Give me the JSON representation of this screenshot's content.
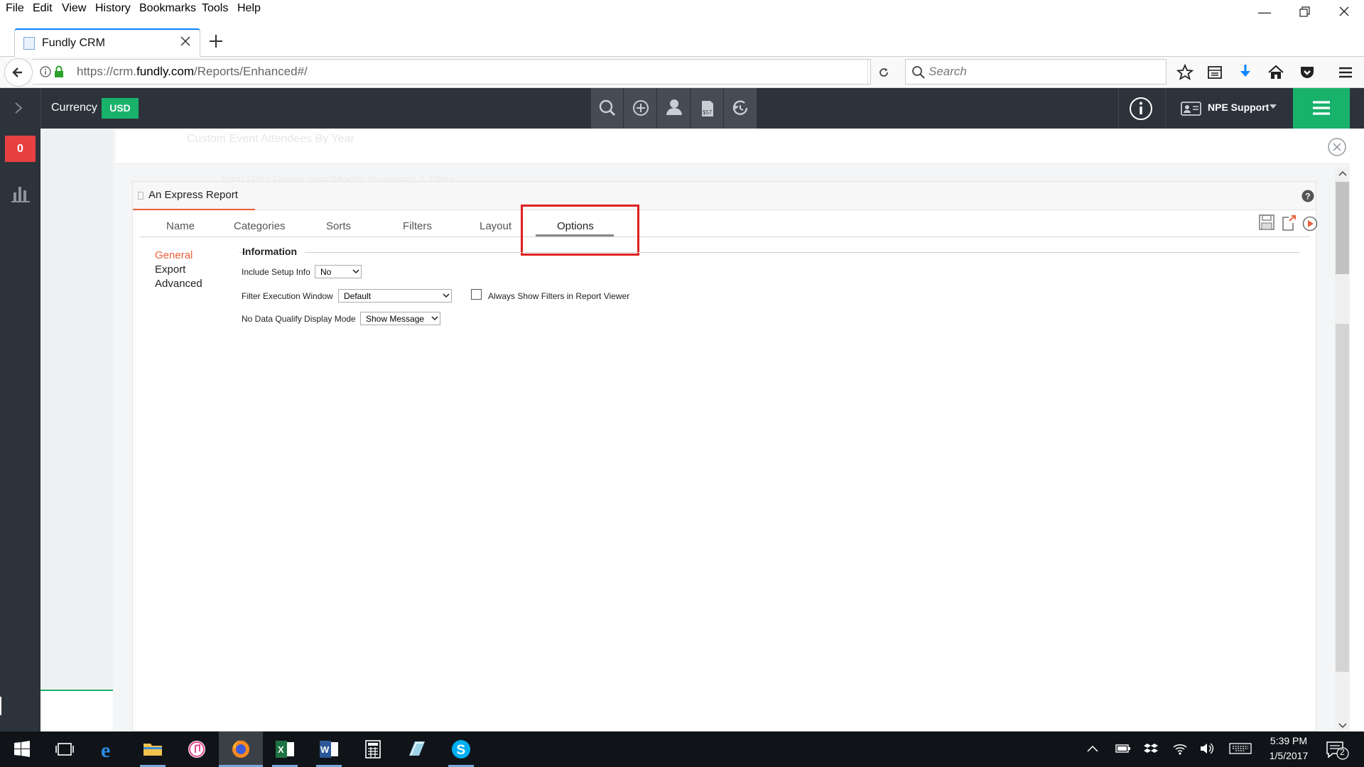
{
  "menu": [
    "File",
    "Edit",
    "View",
    "History",
    "Bookmarks",
    "Tools",
    "Help"
  ],
  "browser": {
    "tab_title": "Fundly CRM",
    "url_prefix": "https://crm.",
    "url_domain": "fundly.com",
    "url_path": "/Reports/Enhanced#/",
    "search_placeholder": "Search"
  },
  "app": {
    "currency_label": "Currency",
    "currency_value": "USD",
    "notification_count": "0",
    "user_name": "NPE Support",
    "colors": {
      "header": "#2d333b",
      "accent_green": "#19b26b",
      "badge_red": "#e84040",
      "active_orange": "#e8603c",
      "highlight_red": "#e02020"
    }
  },
  "background_items": [
    "Custom Event Attendees By Year",
    "Total Gifts Given Year/Month Summary 2 Titles"
  ],
  "report": {
    "title": "An Express Report",
    "tabs": [
      "Name",
      "Categories",
      "Sorts",
      "Filters",
      "Layout",
      "Options"
    ],
    "active_tab": "Options",
    "sidebar": [
      "General",
      "Export",
      "Advanced"
    ],
    "active_section": "General",
    "section_title": "Information",
    "include_setup_label": "Include Setup Info",
    "include_setup_value": "No",
    "filter_window_label": "Filter Execution Window",
    "filter_window_value": "Default",
    "always_show_label": "Always Show Filters in Report Viewer",
    "always_show_checked": false,
    "no_data_label": "No Data Qualify Display Mode",
    "no_data_value": "Show Message"
  },
  "taskbar": {
    "time": "5:39 PM",
    "date": "1/5/2017",
    "notifications": "2"
  }
}
